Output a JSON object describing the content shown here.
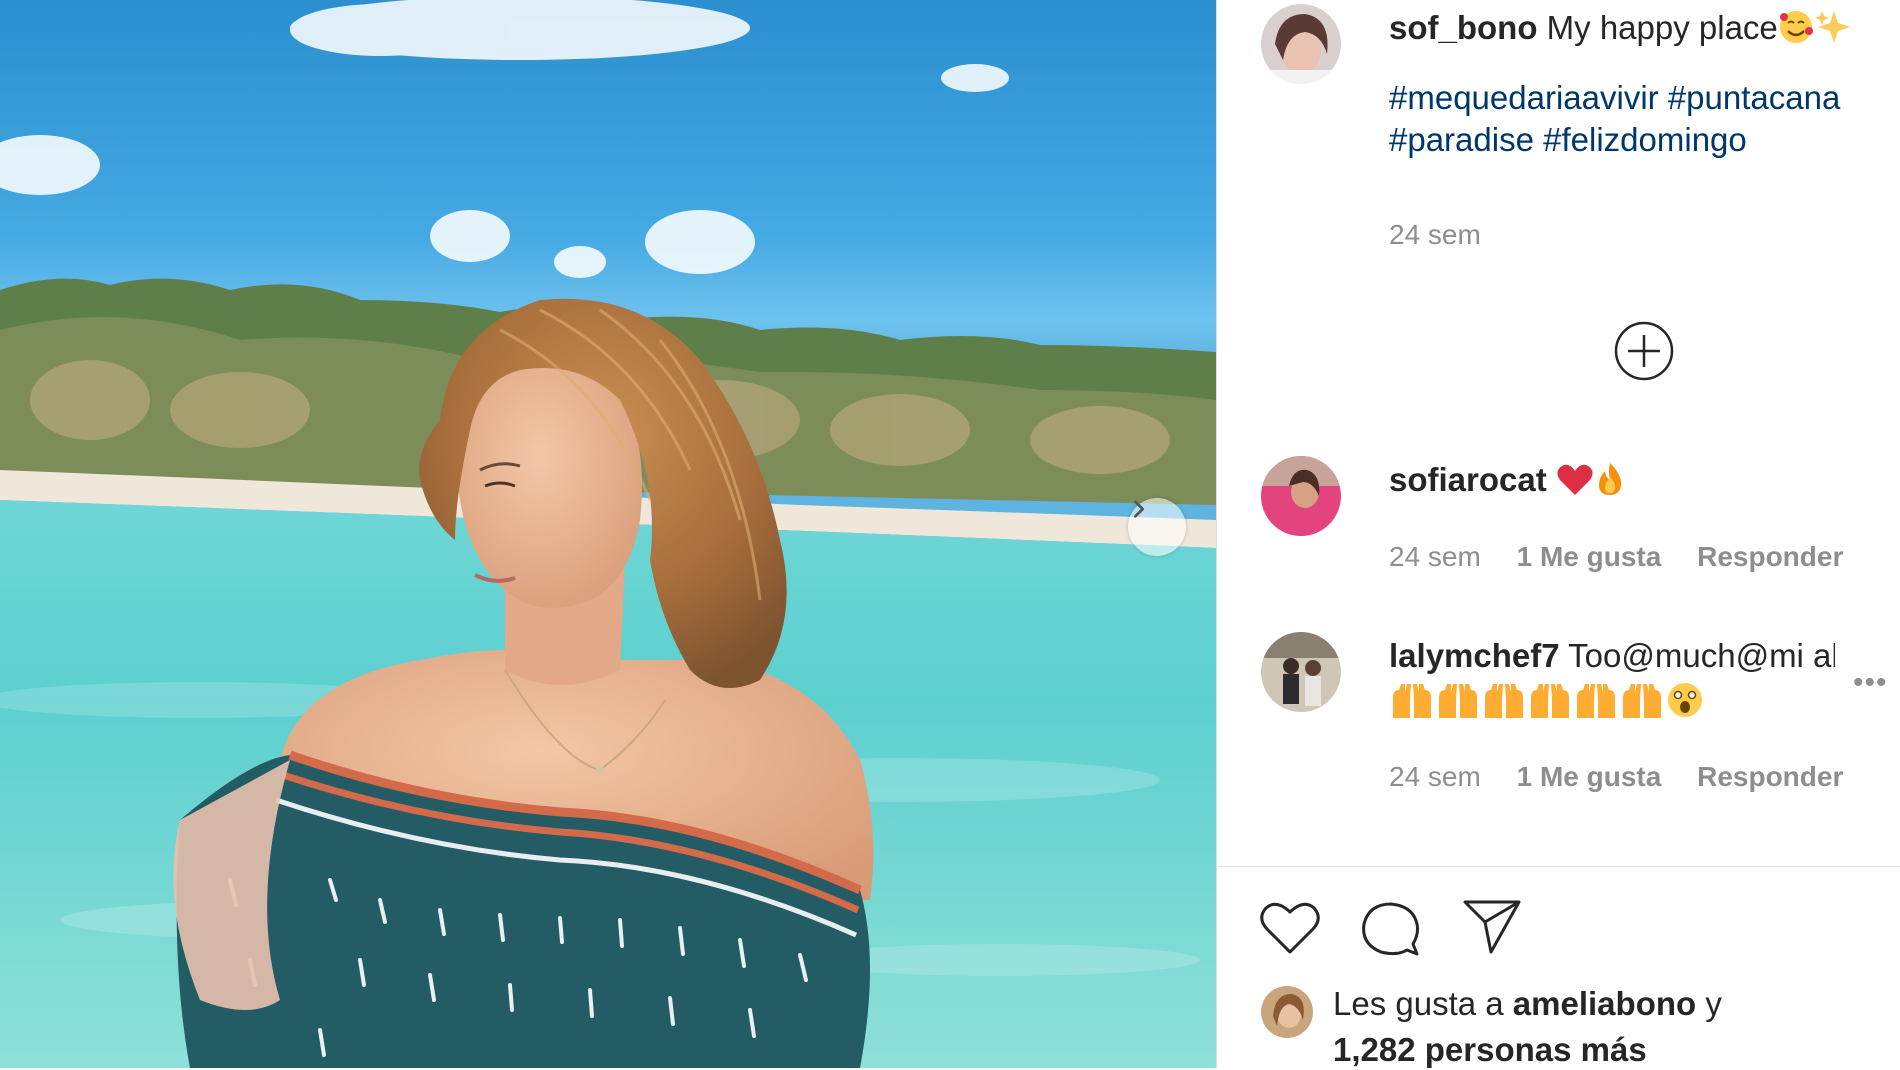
{
  "post": {
    "author": "sof_bono",
    "caption": "My happy place",
    "caption_emojis": [
      "smiling-face-with-hearts",
      "sparkles"
    ],
    "hashtags_line1": [
      "#mequedariaavivir",
      "#puntacana"
    ],
    "hashtags_line2": [
      "#paradise",
      "#felizdomingo"
    ],
    "time": "24 sem"
  },
  "comments": [
    {
      "user": "sofiarocat",
      "text": "",
      "emojis": [
        "red-heart",
        "fire"
      ],
      "time": "24 sem",
      "likes": "1 Me gusta",
      "reply": "Responder"
    },
    {
      "user": "lalymchef7",
      "text": "Too@much@mi ahiii",
      "emojis": [
        "raising-hands",
        "raising-hands",
        "raising-hands",
        "raising-hands",
        "raising-hands",
        "raising-hands",
        "astonished-face"
      ],
      "time": "24 sem",
      "likes": "1 Me gusta",
      "reply": "Responder"
    }
  ],
  "likes": {
    "prefix": "Les gusta a",
    "user": "ameliabono",
    "suffix": "y",
    "count": "1,282 personas más"
  },
  "colors": {
    "sky": "#3fa2dc",
    "water": "#62d0cd",
    "link": "#00376b",
    "muted": "#8e8e8e"
  }
}
